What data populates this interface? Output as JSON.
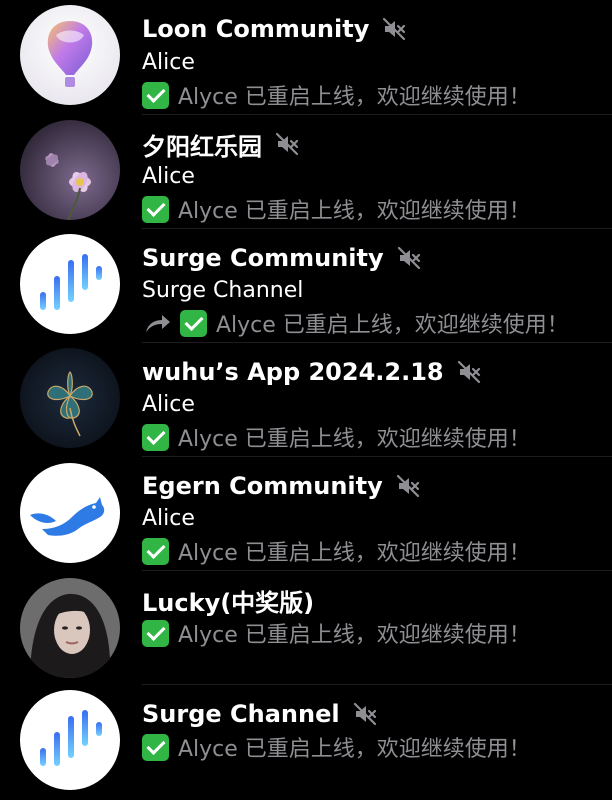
{
  "colors": {
    "background": "#000000",
    "title_text": "#ffffff",
    "message_text": "#8e8e93",
    "check_badge": "#31b545",
    "mute_icon": "#8e8e93",
    "separator": "#1c1c1e"
  },
  "chats": [
    {
      "title": "Loon Community",
      "muted": true,
      "avatar_icon": "hot-air-balloon-icon",
      "sender": "Alice",
      "status_icon": "check-mark-icon",
      "message": "Alyce 已重启上线，欢迎继续使用！"
    },
    {
      "title": "夕阳红乐园",
      "muted": true,
      "avatar_icon": "flower-photo-avatar",
      "sender": "Alice",
      "status_icon": "check-mark-icon",
      "message": "Alyce 已重启上线，欢迎继续使用！"
    },
    {
      "title": "Surge Community",
      "muted": true,
      "avatar_icon": "surge-bars-icon",
      "sender": "Surge Channel",
      "forwarded_icon": "forward-arrow-icon",
      "status_icon": "check-mark-icon",
      "message": "Alyce 已重启上线，欢迎继续使用！"
    },
    {
      "title": "wuhu’s App 2024.2.18",
      "muted": true,
      "avatar_icon": "clover-leaf-icon",
      "sender": "Alice",
      "status_icon": "check-mark-icon",
      "message": "Alyce 已重启上线，欢迎继续使用！"
    },
    {
      "title": "Egern Community",
      "muted": true,
      "avatar_icon": "egern-squirrel-icon",
      "sender": "Alice",
      "status_icon": "check-mark-icon",
      "message": "Alyce 已重启上线，欢迎继续使用！"
    },
    {
      "title": "Lucky(中奖版)",
      "muted": false,
      "avatar_icon": "portrait-photo-avatar",
      "status_icon": "check-mark-icon",
      "message": "Alyce 已重启上线，欢迎继续使用！"
    },
    {
      "title": "Surge Channel",
      "muted": true,
      "avatar_icon": "surge-bars-icon",
      "status_icon": "check-mark-icon",
      "message": "Alyce 已重启上线，欢迎继续使用！"
    }
  ]
}
